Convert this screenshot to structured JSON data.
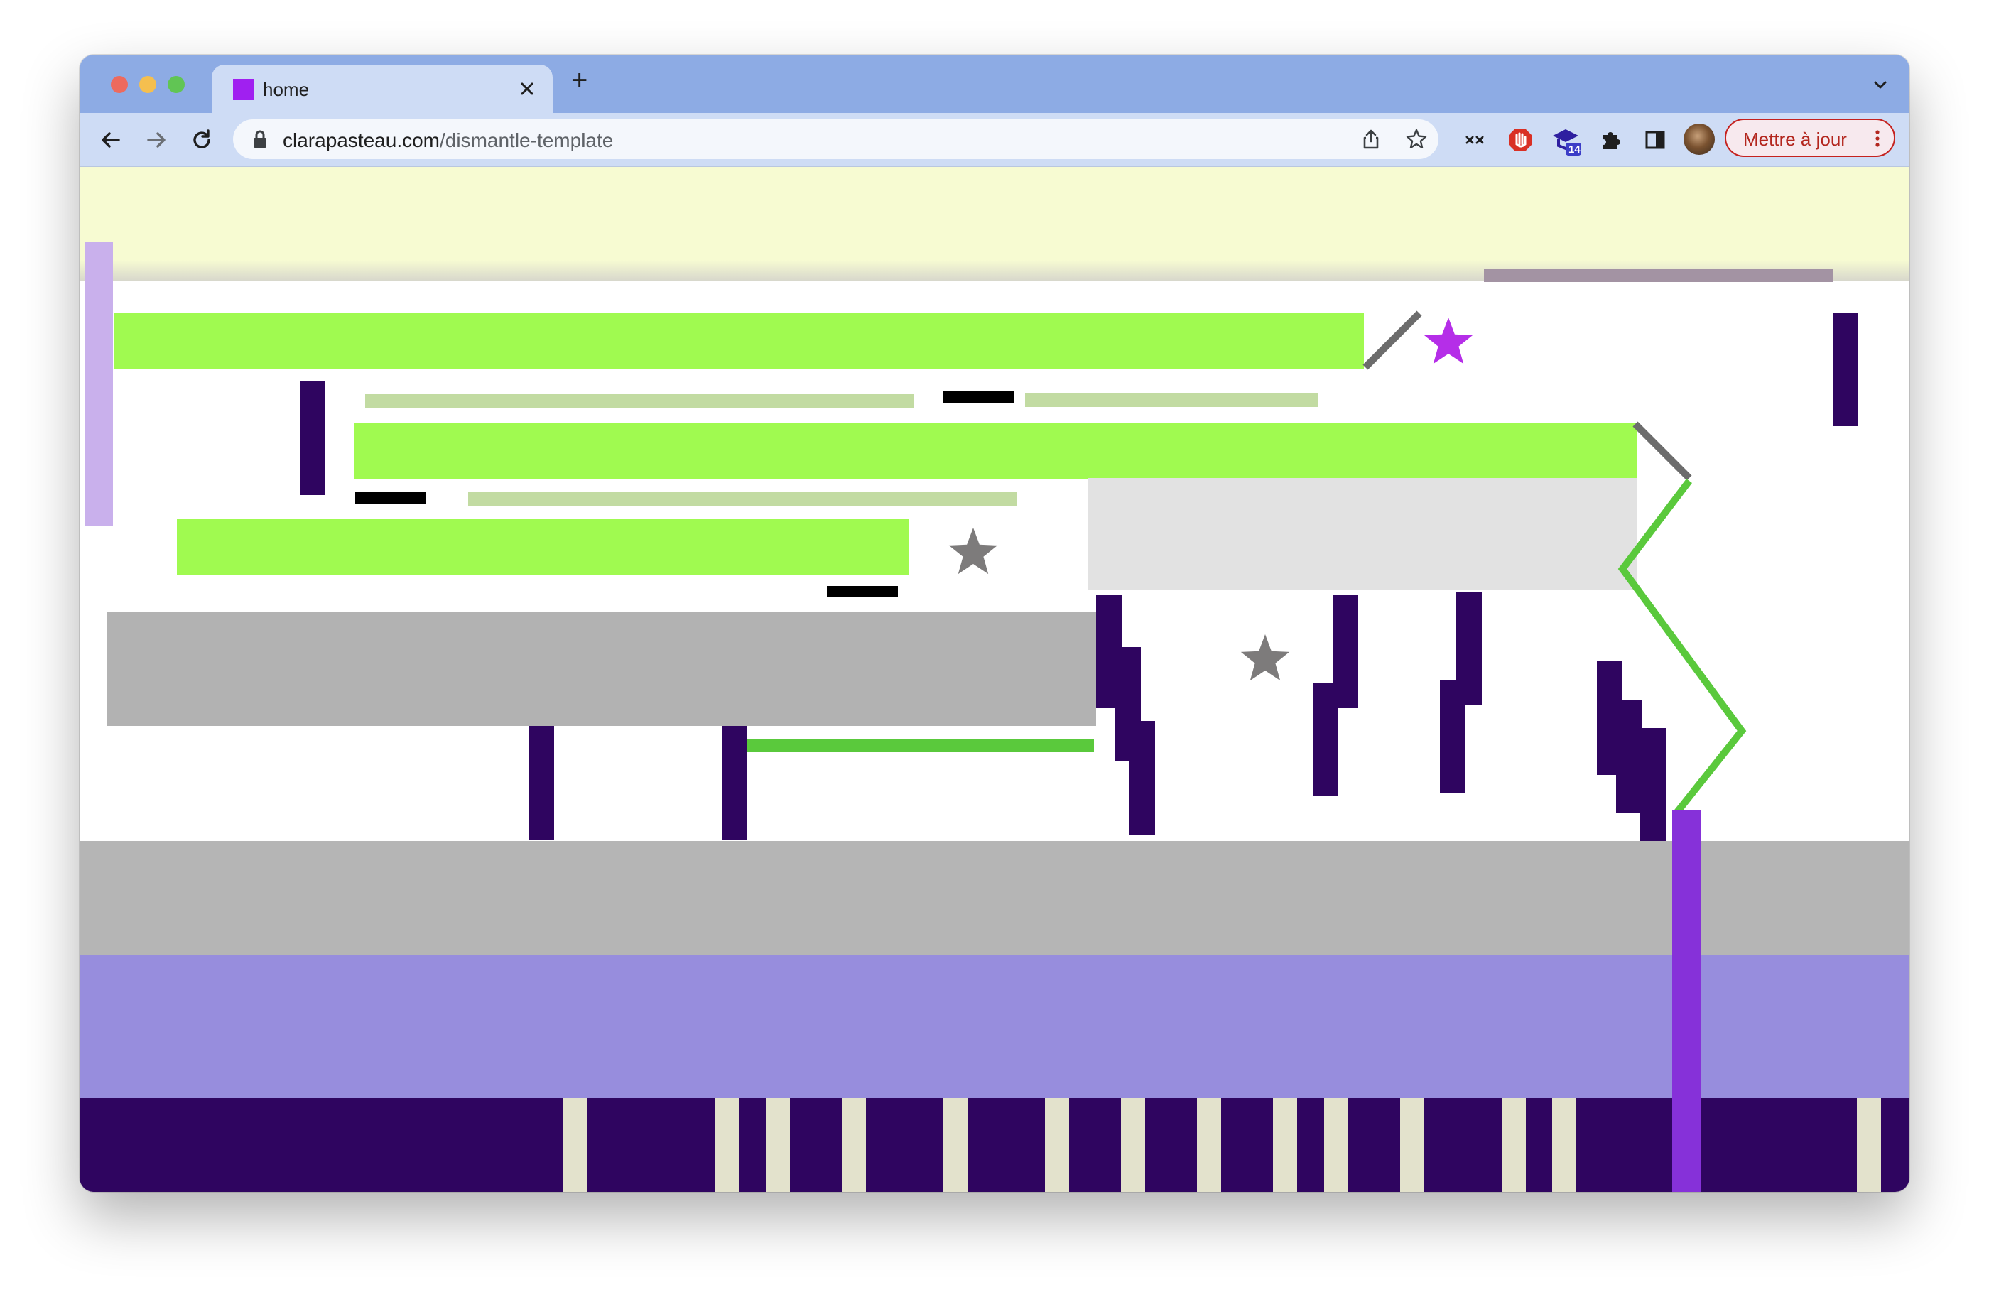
{
  "browser": {
    "tab": {
      "title": "home",
      "favicon_color": "#a020f0"
    },
    "new_tab_label": "+",
    "address": {
      "host": "clarapasteau.com",
      "path": "/dismantle-template"
    },
    "extension_badge": "14",
    "update_button": "Mettre à jour",
    "icons": [
      "back-icon",
      "forward-icon",
      "reload-icon",
      "lock-icon",
      "share-icon",
      "bookmark-star-icon",
      "extension-icon",
      "shield-stop-icon",
      "graduation-cap-icon",
      "puzzle-icon",
      "side-panel-icon",
      "avatar",
      "kebab-menu-icon",
      "tab-search-chevron-icon",
      "close-icon"
    ]
  },
  "colors": {
    "lime": "#a0fa50",
    "pale_green": "#c2dba2",
    "green_line": "#5ac93c",
    "dark_purple": "#2f0560",
    "lavender": "#978ddd",
    "light_lilac": "#c9b0ec",
    "header_cream": "#f7fbd2",
    "gray": "#b5b5b5",
    "light_gray": "#e2e2e2",
    "violet": "#8631d9",
    "magenta_star": "#b52ee8",
    "gray_star": "#7d7b7b",
    "stripe_cream": "#e3e2cc"
  }
}
